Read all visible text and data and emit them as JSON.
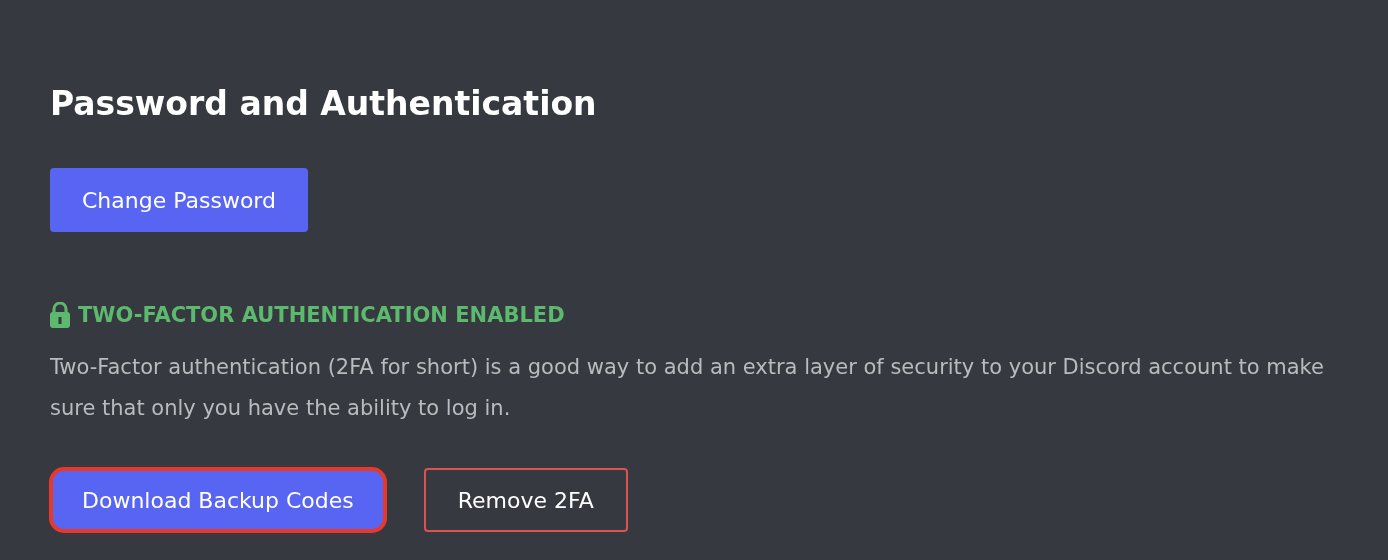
{
  "title": "Password and Authentication",
  "change_password_button": {
    "label": "Change Password"
  },
  "two_factor": {
    "status": "TWO-FACTOR AUTHENTICATION ENABLED",
    "enabled": true,
    "description": "Two-Factor authentication (2FA for short) is a good way to add an extra layer of security to your Discord account to make sure that only you have the ability to log in."
  },
  "buttons": [
    {
      "label": "Download Backup Codes",
      "kind": "primary",
      "highlighted": true
    },
    {
      "label": "Remove 2FA",
      "kind": "danger-outline",
      "highlighted": false
    }
  ]
}
